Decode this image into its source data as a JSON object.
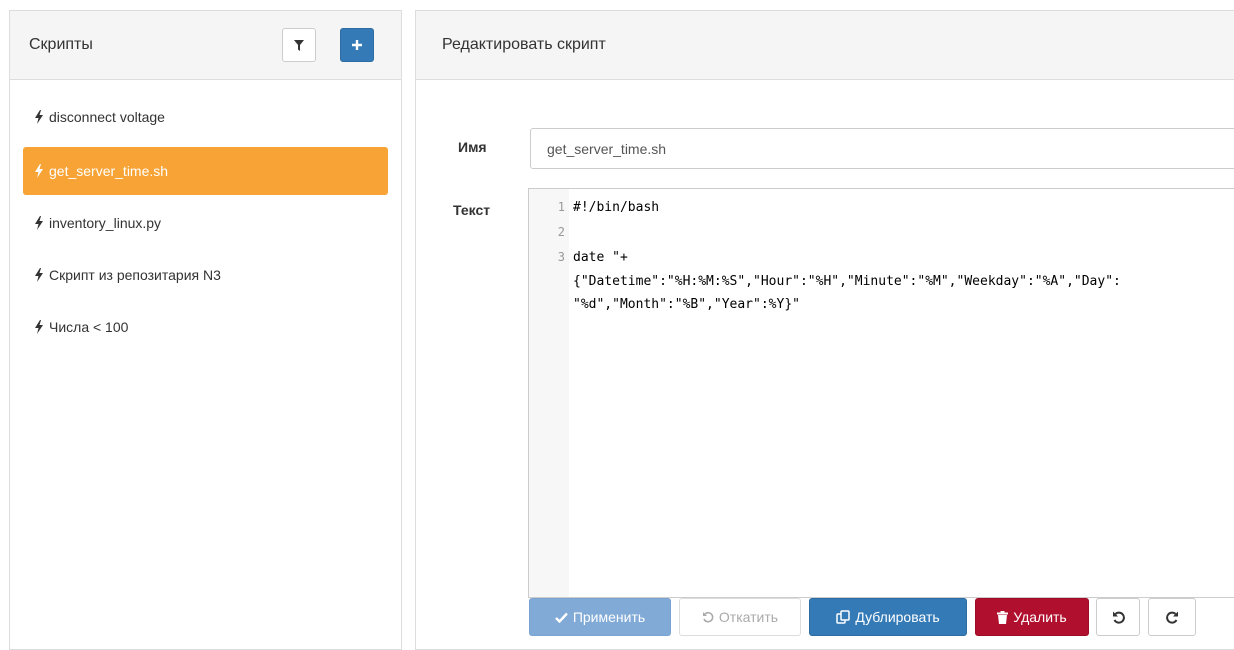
{
  "left_panel": {
    "title": "Скрипты",
    "filter_icon": "filter-icon",
    "add_icon": "plus-icon"
  },
  "scripts": [
    {
      "name": "disconnect voltage",
      "active": false
    },
    {
      "name": "get_server_time.sh",
      "active": true
    },
    {
      "name": "inventory_linux.py",
      "active": false
    },
    {
      "name": "Скрипт из репозитария N3",
      "active": false
    },
    {
      "name": "Числа < 100",
      "active": false
    }
  ],
  "editor_panel": {
    "title": "Редактировать скрипт",
    "name_label": "Имя",
    "name_value": "get_server_time.sh",
    "text_label": "Текст",
    "code": {
      "line1_no": "1",
      "line1": "#!/bin/bash",
      "line2_no": "2",
      "line3_no": "3",
      "line3a": "date \"+",
      "line3b": "{\"Datetime\":\"%H:%M:%S\",\"Hour\":\"%H\",\"Minute\":\"%M\",\"Weekday\":\"%A\",\"Day\":",
      "line3c": "\"%d\",\"Month\":\"%B\",\"Year\":%Y}\""
    }
  },
  "buttons": {
    "apply": "Применить",
    "revert": "Откатить",
    "duplicate": "Дублировать",
    "delete": "Удалить"
  },
  "colors": {
    "active_item": "#f7a335",
    "primary": "#337ab7",
    "danger": "#b0102e"
  }
}
